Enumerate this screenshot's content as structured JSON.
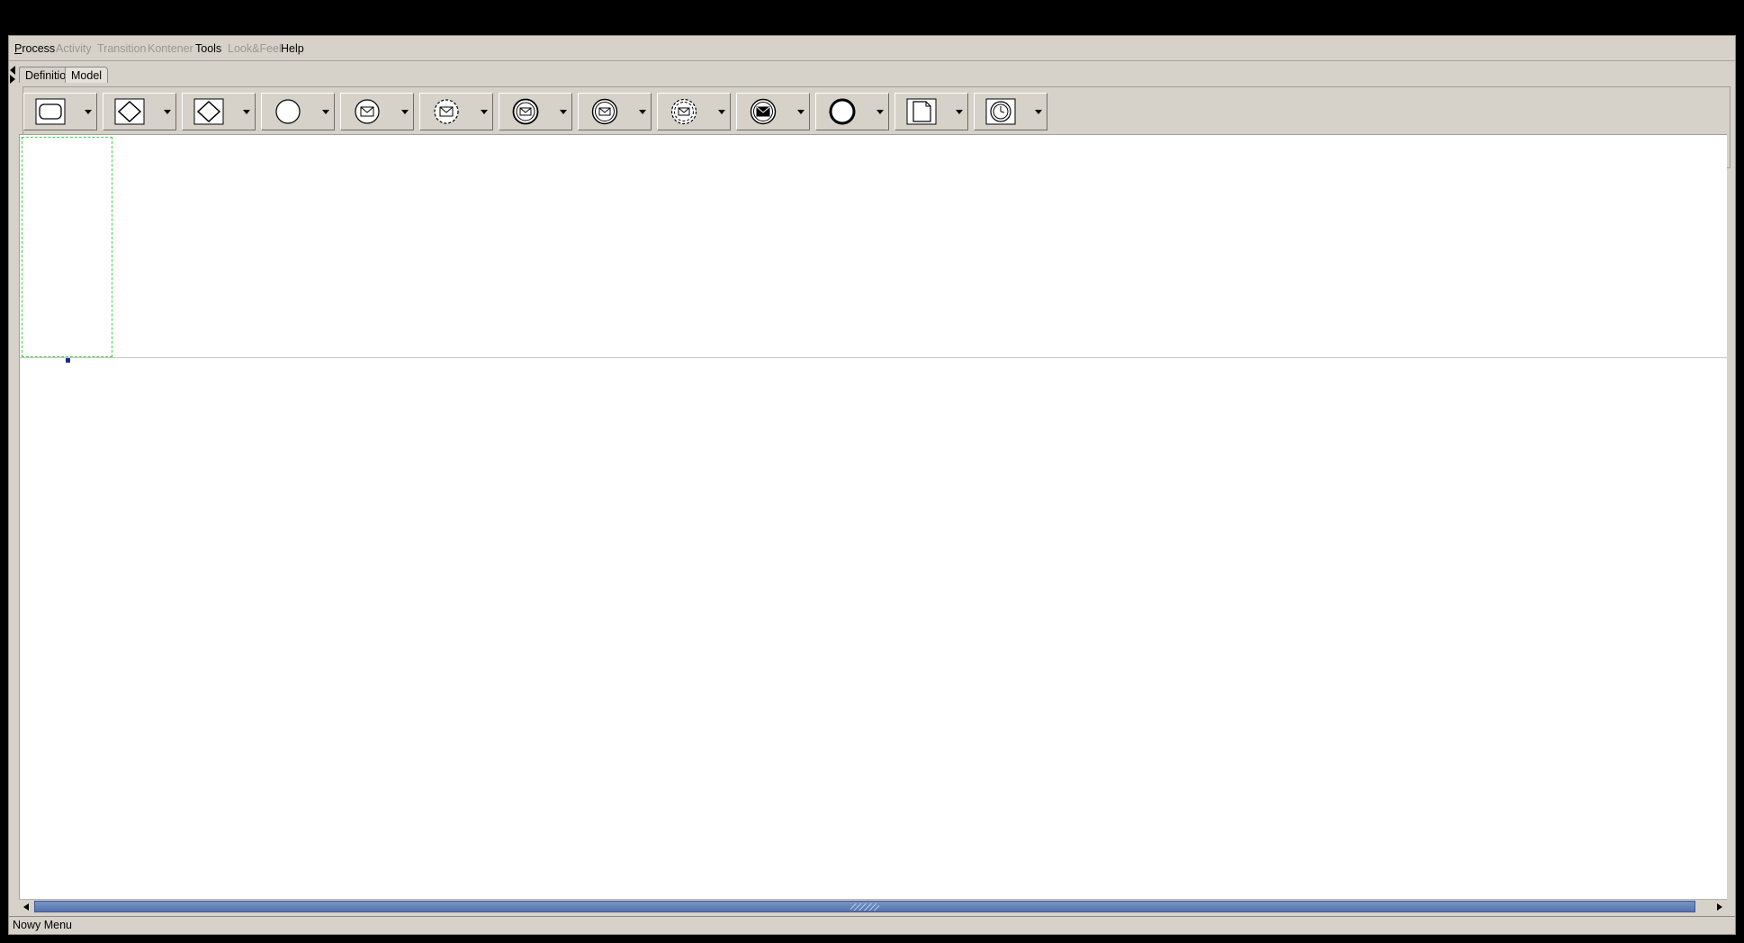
{
  "menu": [
    {
      "label": "Process",
      "enabled": true
    },
    {
      "label": "Activity",
      "enabled": false
    },
    {
      "label": "Transition",
      "enabled": false
    },
    {
      "label": "Kontener",
      "enabled": false
    },
    {
      "label": "Tools",
      "enabled": true
    },
    {
      "label": "Look&Feel",
      "enabled": false
    },
    {
      "label": "Help",
      "enabled": true
    }
  ],
  "tabs": [
    {
      "label": "Definition",
      "active": false
    },
    {
      "label": "Model",
      "active": true
    }
  ],
  "toolbar": {
    "tools": [
      {
        "icon": "rounded-rectangle-activity-icon"
      },
      {
        "icon": "gateway-diamond-icon"
      },
      {
        "icon": "gateway-diamond-alt-icon"
      },
      {
        "icon": "circle-start-event-icon"
      },
      {
        "icon": "message-start-event-icon"
      },
      {
        "icon": "message-dashed-event-icon"
      },
      {
        "icon": "message-intermediate-event-icon"
      },
      {
        "icon": "message-intermediate-alt-icon"
      },
      {
        "icon": "message-dashed-double-event-icon"
      },
      {
        "icon": "message-filled-event-icon"
      },
      {
        "icon": "bold-circle-end-event-icon"
      },
      {
        "icon": "document-artifact-icon"
      },
      {
        "icon": "timer-event-icon"
      }
    ]
  },
  "status": {
    "text": "Nowy Menu"
  },
  "colors": {
    "window_bg": "#d6d2ca",
    "lane_selection": "#39d63f",
    "scroll_thumb": "#5473ad",
    "handle": "#1a2c8a"
  }
}
